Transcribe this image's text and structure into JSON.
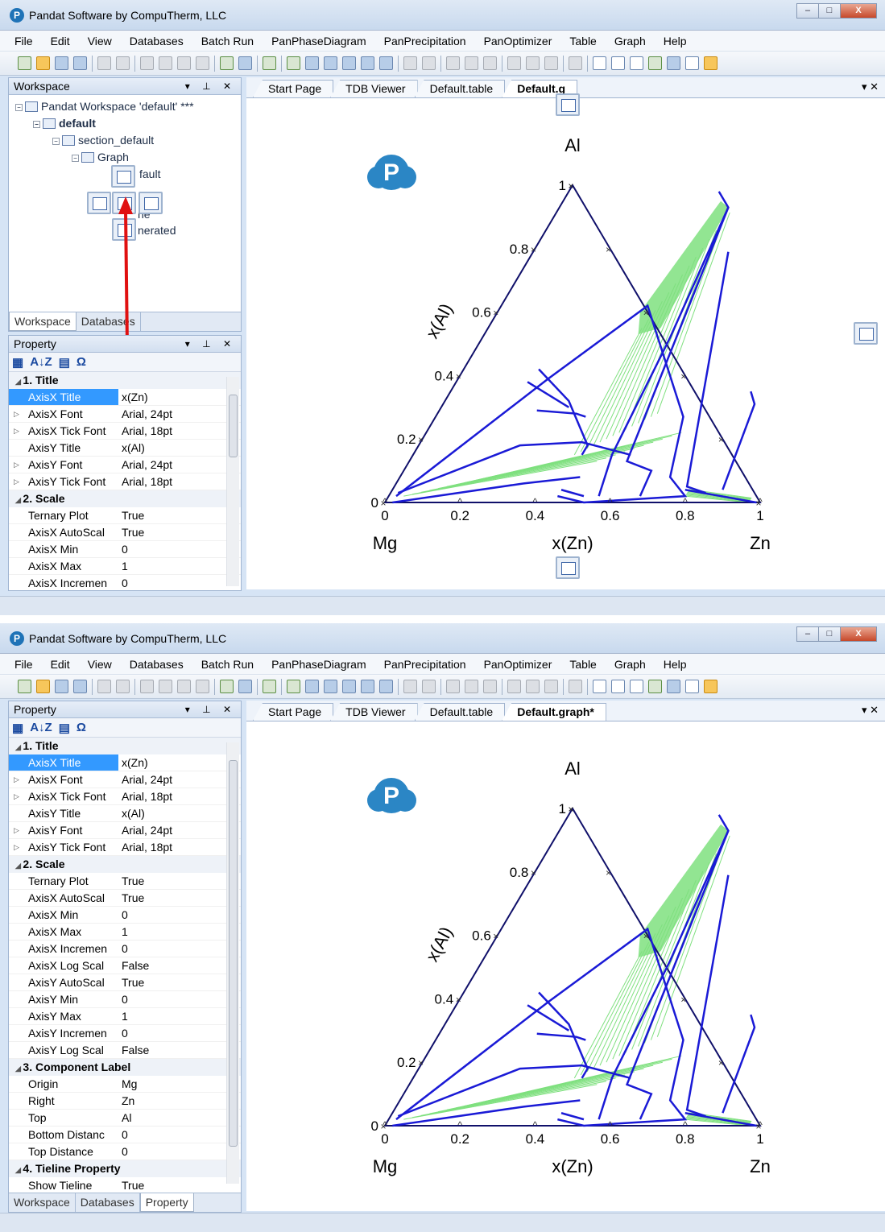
{
  "window": {
    "title": "Pandat Software by CompuTherm, LLC",
    "min_glyph": "–",
    "max_glyph": "□",
    "close_glyph": "X"
  },
  "menu": [
    "File",
    "Edit",
    "View",
    "Databases",
    "Batch Run",
    "PanPhaseDiagram",
    "PanPrecipitation",
    "PanOptimizer",
    "Table",
    "Graph",
    "Help"
  ],
  "workspace": {
    "title": "Workspace",
    "items": [
      {
        "label": "Pandat Workspace 'default' ***",
        "depth": 0
      },
      {
        "label": "default",
        "depth": 1,
        "bold": true
      },
      {
        "label": "section_default",
        "depth": 2
      },
      {
        "label": "Graph",
        "depth": 3
      },
      {
        "label": "fault",
        "depth": 4
      },
      {
        "label": "ne",
        "depth": 5
      },
      {
        "label": "nerated",
        "depth": 5
      }
    ],
    "tabs": [
      "Workspace",
      "Databases"
    ]
  },
  "property": {
    "title": "Property",
    "toolbar_glyphs": [
      "▦",
      "A↓Z",
      "▤",
      "Ω"
    ],
    "rows": [
      {
        "cat": "1. Title"
      },
      {
        "n": "AxisX Title",
        "v": "x(Zn)",
        "sel": true
      },
      {
        "n": "AxisX Font",
        "v": "Arial, 24pt",
        "exp": true
      },
      {
        "n": "AxisX Tick Font",
        "v": "Arial, 18pt",
        "exp": true
      },
      {
        "n": "AxisY Title",
        "v": "x(Al)"
      },
      {
        "n": "AxisY Font",
        "v": "Arial, 24pt",
        "exp": true
      },
      {
        "n": "AxisY Tick Font",
        "v": "Arial, 18pt",
        "exp": true
      },
      {
        "cat": "2. Scale"
      },
      {
        "n": "Ternary Plot",
        "v": "True"
      },
      {
        "n": "AxisX AutoScal",
        "v": "True"
      },
      {
        "n": "AxisX Min",
        "v": "0"
      },
      {
        "n": "AxisX Max",
        "v": "1"
      },
      {
        "n": "AxisX Incremen",
        "v": "0"
      },
      {
        "n": "AxisX Log Scal",
        "v": "False"
      },
      {
        "n": "AxisY AutoScal",
        "v": "True"
      },
      {
        "n": "AxisY Min",
        "v": "0"
      },
      {
        "n": "AxisY Max",
        "v": "1"
      },
      {
        "n": "AxisY Incremen",
        "v": "0"
      },
      {
        "n": "AxisY Log Scal",
        "v": "False"
      },
      {
        "cat": "3. Component Label"
      },
      {
        "n": "Origin",
        "v": "Mg"
      },
      {
        "n": "Right",
        "v": "Zn"
      },
      {
        "n": "Top",
        "v": "Al"
      },
      {
        "n": "Bottom Distanc",
        "v": "0"
      },
      {
        "n": "Top Distance",
        "v": "0"
      },
      {
        "cat": "4. Tieline Property"
      },
      {
        "n": "Show Tieline",
        "v": "True"
      }
    ],
    "tabs2": [
      "Workspace",
      "Databases",
      "Property"
    ]
  },
  "doc_tabs": {
    "first": [
      "Start Page",
      "TDB Viewer",
      "Default.table",
      "Default.g"
    ],
    "second": [
      "Start Page",
      "TDB Viewer",
      "Default.table",
      "Default.graph*"
    ],
    "ctrl": "▾ ✕"
  },
  "chart_data": {
    "type": "scatter",
    "plot_kind": "ternary phase diagram",
    "components": {
      "origin": "Mg",
      "right": "Zn",
      "top": "Al"
    },
    "xlabel": "x(Zn)",
    "ylabel": "x(Al)",
    "ticks": [
      "0",
      "0.2",
      "0.4",
      "0.6",
      "0.8",
      "1"
    ],
    "xlim": [
      0,
      1
    ],
    "ylim": [
      0,
      1
    ],
    "colors": {
      "boundary": "#1a1ad6",
      "tieline": "#7fe07f",
      "frame": "#10106a"
    },
    "boundaries": [
      [
        [
          0.02,
          0.02
        ],
        [
          0.24,
          0.39
        ],
        [
          0.39,
          0.62
        ],
        [
          0.66,
          0.27
        ],
        [
          0.72,
          0.08
        ],
        [
          0.79,
          0.02
        ],
        [
          0.53,
          0.0
        ],
        [
          0.45,
          0.02
        ]
      ],
      [
        [
          0.4,
          0.98
        ],
        [
          0.45,
          0.93
        ],
        [
          0.58,
          0.13
        ],
        [
          0.66,
          0.1
        ],
        [
          0.67,
          0.02
        ]
      ],
      [
        [
          0.45,
          0.93
        ],
        [
          0.5,
          0.52
        ],
        [
          0.53,
          0.15
        ],
        [
          0.56,
          0.02
        ]
      ],
      [
        [
          0.52,
          0.79
        ],
        [
          0.78,
          0.05
        ],
        [
          0.84,
          0.03
        ]
      ],
      [
        [
          0.2,
          0.42
        ],
        [
          0.33,
          0.32
        ],
        [
          0.45,
          0.18
        ],
        [
          0.45,
          0.15
        ]
      ],
      [
        [
          0.19,
          0.38
        ],
        [
          0.34,
          0.3
        ]
      ],
      [
        [
          0.02,
          0.03
        ],
        [
          0.27,
          0.18
        ],
        [
          0.43,
          0.19
        ],
        [
          0.58,
          0.15
        ]
      ],
      [
        [
          0.02,
          0.0
        ],
        [
          0.34,
          0.06
        ],
        [
          0.48,
          0.08
        ]
      ],
      [
        [
          0.8,
          0.35
        ],
        [
          0.83,
          0.31
        ],
        [
          0.88,
          0.04
        ]
      ],
      [
        [
          0.78,
          0.04
        ],
        [
          0.99,
          0.0
        ]
      ],
      [
        [
          0.26,
          0.29
        ],
        [
          0.37,
          0.28
        ],
        [
          0.4,
          0.27
        ]
      ],
      [
        [
          0.45,
          0.04
        ],
        [
          0.52,
          0.02
        ]
      ]
    ],
    "tieline_band": [
      [
        0.42,
        0.95
      ],
      [
        0.45,
        0.93
      ],
      [
        0.46,
        0.55
      ],
      [
        0.41,
        0.53
      ],
      [
        0.38,
        0.6
      ]
    ]
  },
  "dock_labels": {
    "hint": "dock"
  }
}
